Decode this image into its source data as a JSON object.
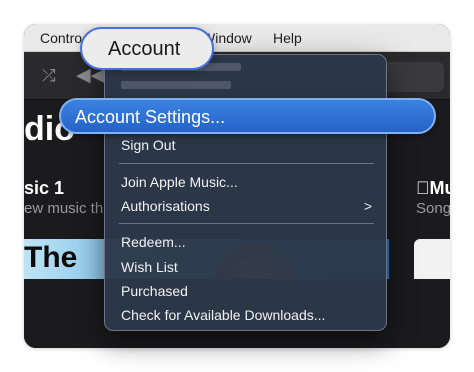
{
  "menubar": {
    "items": [
      "Contro",
      "Window",
      "Help"
    ]
  },
  "callout": {
    "label": "Account"
  },
  "dropdown": {
    "highlighted": "Account Settings...",
    "items": [
      "Sign Out",
      "Join Apple Music...",
      "Authorisations",
      "Redeem...",
      "Wish List",
      "Purchased",
      "Check for Available Downloads..."
    ],
    "submenu_indicator": ">"
  },
  "background": {
    "big_title": "dio",
    "sub_title": "sic 1",
    "sub_text": "ew music th",
    "right_title": "Mu",
    "right_text": "Song",
    "card_text": "The"
  },
  "toolbar": {
    "shuffle_icon": "shuffle-icon",
    "rewind_icon": "rewind-icon"
  },
  "colors": {
    "highlight": "#2563c8",
    "callout_border": "#4a6fd9",
    "menu_bg": "#2c3748"
  }
}
